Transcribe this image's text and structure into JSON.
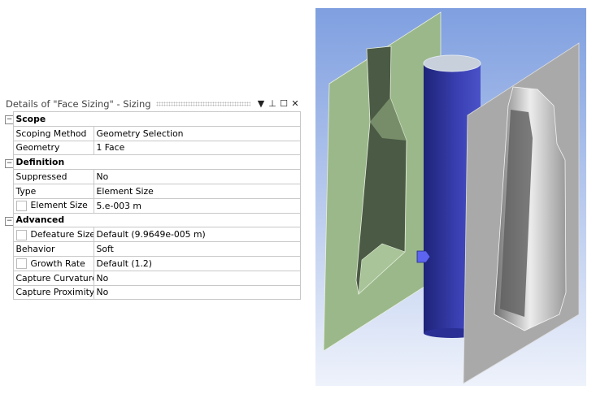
{
  "panel": {
    "title": "Details of \"Face Sizing\" - Sizing",
    "menu_icon": "dropdown-arrow-icon",
    "pin_icon": "pin-icon",
    "maximize_icon": "maximize-icon",
    "close_icon": "close-icon"
  },
  "groups": [
    {
      "name": "Scope",
      "rows": [
        {
          "label": "Scoping Method",
          "value": "Geometry Selection",
          "checkbox": false
        },
        {
          "label": "Geometry",
          "value": "1 Face",
          "checkbox": false
        }
      ]
    },
    {
      "name": "Definition",
      "rows": [
        {
          "label": "Suppressed",
          "value": "No",
          "checkbox": false
        },
        {
          "label": "Type",
          "value": "Element Size",
          "checkbox": false
        },
        {
          "label": "Element Size",
          "value": "5.e-003 m",
          "checkbox": true
        }
      ]
    },
    {
      "name": "Advanced",
      "rows": [
        {
          "label": "Defeature Size",
          "value": "Default (9.9649e-005 m)",
          "checkbox": true
        },
        {
          "label": "Behavior",
          "value": "Soft",
          "checkbox": false
        },
        {
          "label": "Growth Rate",
          "value": "Default (1.2)",
          "checkbox": true
        },
        {
          "label": "Capture Curvature",
          "value": "No",
          "checkbox": false
        },
        {
          "label": "Capture Proximity",
          "value": "No",
          "checkbox": false
        }
      ]
    }
  ],
  "colors": {
    "mold_left": "#9bb88a",
    "mold_right": "#a9a9a9",
    "cylinder": "#3a3fb0",
    "bg_top": "#7f9fe0",
    "bg_bottom": "#e8eefa"
  }
}
